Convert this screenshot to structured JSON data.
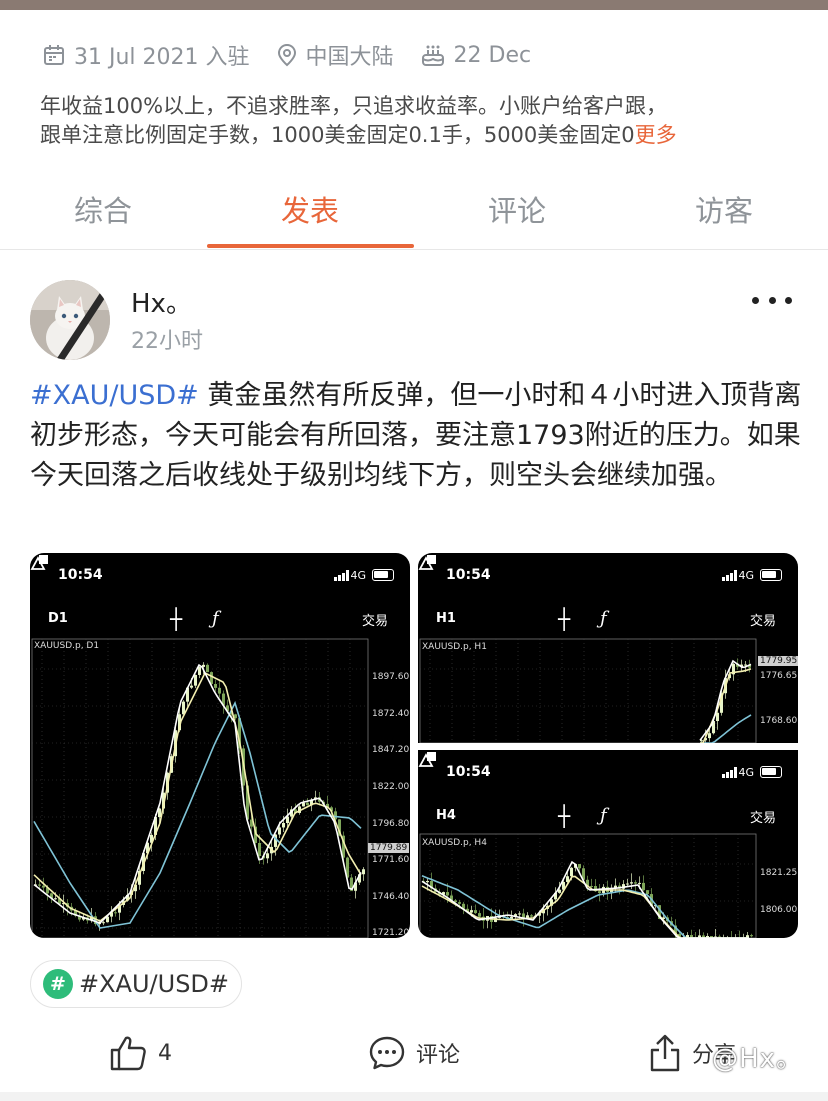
{
  "profile_meta": {
    "joined": "31 Jul 2021 入驻",
    "location": "中国大陆",
    "birthday": "22 Dec",
    "icons": [
      "calendar-icon",
      "location-pin-icon",
      "birthday-cake-icon"
    ]
  },
  "bio": {
    "line1": "年收益100%以上，不追求胜率，只追求收益率。小账户给客户跟，",
    "line2": "跟单注意比例固定手数，1000美金固定0.1手，5000美金固定0",
    "more_label": "更多"
  },
  "tabs": [
    {
      "label": "综合",
      "active": false
    },
    {
      "label": "发表",
      "active": true
    },
    {
      "label": "评论",
      "active": false
    },
    {
      "label": "访客",
      "active": false
    }
  ],
  "post": {
    "author": "Hx。",
    "time": "22小时",
    "hashtag": "#XAU/USD#",
    "body": " 黄金虽然有所反弹，但一小时和４小时进入顶背离初步形态，今天可能会有所回落，要注意1793附近的压力。如果今天回落之后收线处于级别均线下方，则空头会继续加强。",
    "tag_chip": "#XAU/USD#",
    "tag_icon": "#"
  },
  "screenshots": [
    {
      "status_time": "10:54",
      "network": "4G",
      "timeframe": "D1",
      "trade_label": "交易",
      "symbol": "XAUUSD.p, D1",
      "price_ticks": [
        "1897.60",
        "1872.40",
        "1847.20",
        "1822.00",
        "1796.80",
        "1771.60",
        "1746.40",
        "1721.20"
      ],
      "current_price": "1779.89"
    },
    {
      "status_time": "10:54",
      "network": "4G",
      "timeframe": "H1",
      "trade_label": "交易",
      "symbol": "XAUUSD.p, H1",
      "price_ticks": [
        "1776.65",
        "1768.60"
      ],
      "current_price": "1779.95"
    },
    {
      "status_time": "10:54",
      "network": "4G",
      "timeframe": "H4",
      "trade_label": "交易",
      "symbol": "XAUUSD.p, H4",
      "price_ticks": [
        "1821.25",
        "1806.00"
      ]
    }
  ],
  "actions": {
    "like_count": "4",
    "comment_label": "评论",
    "share_label": "分享"
  },
  "watermark": "@Hx。",
  "colors": {
    "accent": "#e8663a",
    "hashtag": "#3b6fd1",
    "tag_green": "#2ebc7a",
    "muted": "#8d9298"
  }
}
